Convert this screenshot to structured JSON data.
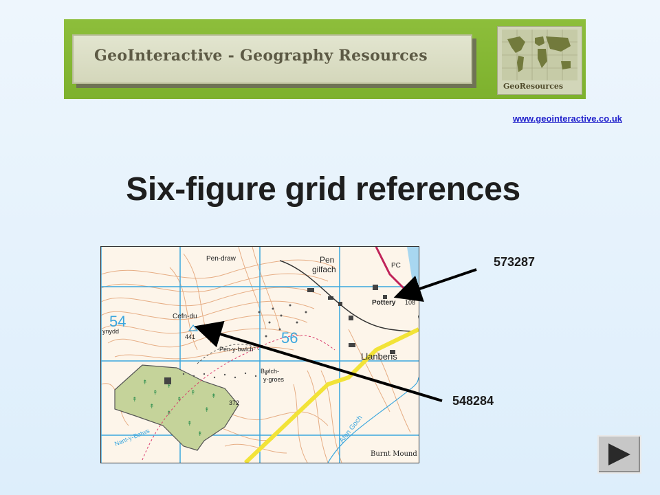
{
  "banner": {
    "title": "GeoInteractive - Geography Resources",
    "logo_text": "GeoResources"
  },
  "link": {
    "url_text": "www.geointeractive.co.uk"
  },
  "slide": {
    "title": "Six-figure grid references"
  },
  "references": [
    {
      "label": "573287"
    },
    {
      "label": "548284"
    }
  ],
  "map": {
    "place_labels": [
      "Pen-draw",
      "Pen",
      "gilfach",
      "PC",
      "Pottery",
      "Cefn-du",
      "441",
      "Pen-y-bwlch",
      "Llanberis",
      "Bwlch-",
      "y-groes",
      "372",
      "Nant-y-Betws",
      "Afon Goch",
      "Burnt Mound",
      "ynydd",
      "108"
    ],
    "grid_numbers": [
      "54",
      "56"
    ]
  },
  "nav": {
    "icon": "play-next-icon"
  },
  "colors": {
    "banner_green": "#7db12d",
    "link_blue": "#2222cc",
    "grid_blue": "#3aa6de",
    "contour_orange": "#e3a77a",
    "wood_green": "#c5d39a"
  }
}
